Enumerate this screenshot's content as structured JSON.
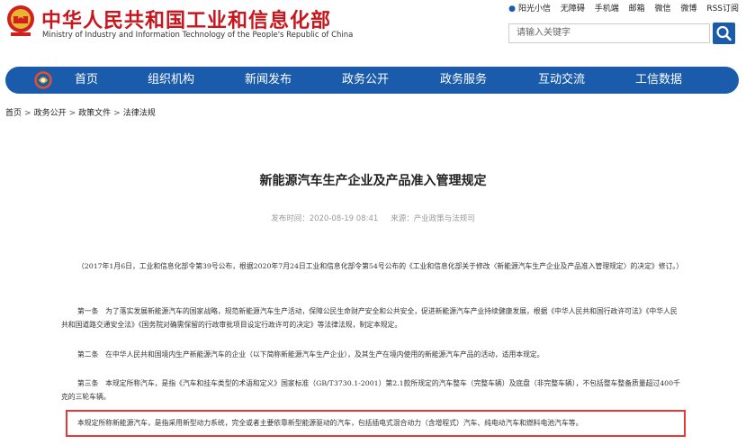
{
  "header": {
    "site_title": "中华人民共和国工业和信息化部",
    "site_subtitle": "Ministry of Industry and Information Technology of the People's Republic of China",
    "top_links": [
      "阳光小信",
      "无障碍",
      "手机端",
      "邮箱",
      "微信",
      "微博",
      "RSS订阅"
    ],
    "search_placeholder": "请输入关键字"
  },
  "nav": {
    "items": [
      "首页",
      "组织机构",
      "新闻发布",
      "政务公开",
      "政务服务",
      "互动交流",
      "工信数据"
    ]
  },
  "breadcrumb": [
    "首页",
    "政务公开",
    "政策文件",
    "法律法规"
  ],
  "breadcrumb_separator": ">",
  "article": {
    "title": "新能源汽车生产企业及产品准入管理规定",
    "publish_time": "发布时间：2020-08-19 08:41",
    "source": "来源：产业政策与法规司",
    "paragraphs": [
      "（2017年1月6日，工业和信息化部令第39号公布，根据2020年7月24日工业和信息化部令第54号公布的《工业和信息化部关于修改〈新能源汽车生产企业及产品准入管理规定〉的决定》修订。）",
      "第一条　为了落实发展新能源汽车的国家战略，规范新能源汽车生产活动，保障公民生命财产安全和公共安全，促进新能源汽车产业持续健康发展，根据《中华人民共和国行政许可法》《中华人民共和国道路交通安全法》《国务院对确需保留的行政审批项目设定行政许可的决定》等法律法规，制定本规定。",
      "第二条　在中华人民共和国境内生产新能源汽车的企业（以下简称新能源汽车生产企业），及其生产在境内使用的新能源汽车产品的活动，适用本规定。",
      "第三条　本规定所称汽车，是指《汽车和挂车类型的术语和定义》国家标准（GB/T3730.1-2001）第2.1款所规定的汽车整车（完整车辆）及底盘（非完整车辆），不包括整车整备质量超过400千克的三轮车辆。",
      "本规定所称新能源汽车，是指采用新型动力系统，完全或者主要依靠新型能源驱动的汽车，包括插电式混合动力（含增程式）汽车、纯电动汽车和燃料电池汽车等。"
    ]
  },
  "colors": {
    "brand_red": "#c8161d",
    "nav_blue": "#1a5cab",
    "highlight_border": "#e53a3a"
  }
}
